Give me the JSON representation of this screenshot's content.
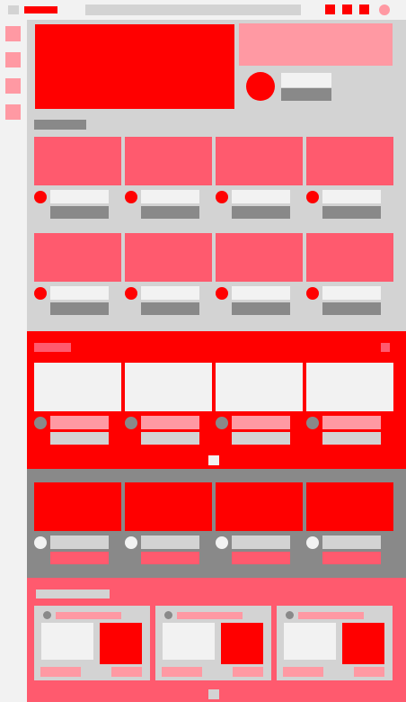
{
  "app": {
    "title": "",
    "colors": {
      "brand": "#ff0000",
      "accent_pink": "#ff5a6e",
      "light_pink": "#ff99a3",
      "background": "#f2f2f2",
      "content_gray": "#d3d3d3",
      "mid_gray": "#898989"
    }
  },
  "topbar": {
    "icons": [
      "menu-icon",
      "logo",
      "search-field",
      "upload-icon",
      "apps-icon",
      "notifications-icon",
      "avatar"
    ]
  },
  "sidebar": {
    "items": [
      "home",
      "shorts",
      "subscriptions",
      "library"
    ]
  },
  "featured": {
    "badge": "",
    "title": "",
    "meta": ""
  },
  "sections": [
    {
      "id": "section-1",
      "title": "",
      "rows": 2,
      "cards_per_row": 4
    },
    {
      "id": "section-2",
      "title": "",
      "rows": 1,
      "cards_per_row": 4
    },
    {
      "id": "section-3",
      "title": "",
      "rows": 1,
      "cards_per_row": 4
    },
    {
      "id": "section-4",
      "title": "",
      "rows": 1,
      "cards_per_row": 3
    }
  ]
}
